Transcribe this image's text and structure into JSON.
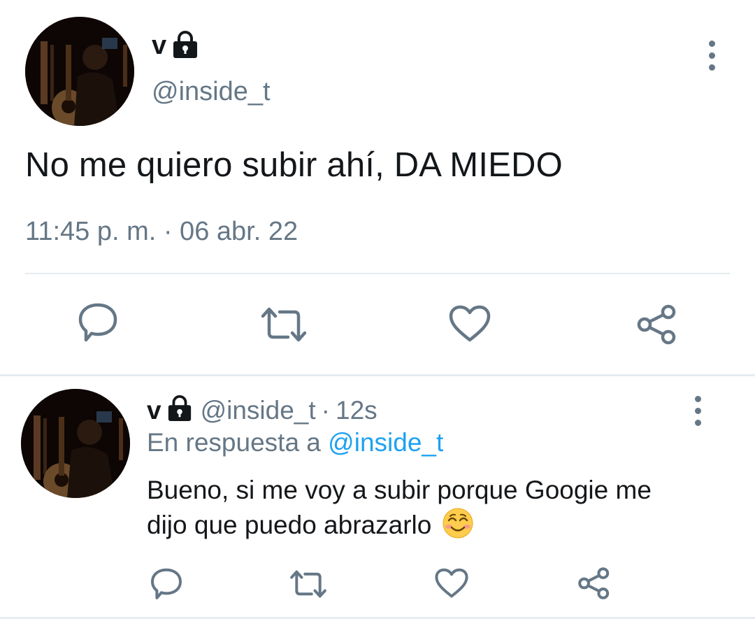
{
  "main_tweet": {
    "display_name": "v",
    "handle": "@inside_t",
    "text": "No me quiero subir ahí, DA MIEDO",
    "timestamp": "11:45 p. m. · 06 abr. 22"
  },
  "reply_tweet": {
    "display_name": "v",
    "handle": "@inside_t",
    "separator": "·",
    "time": "12s",
    "reply_prefix": "En respuesta a",
    "reply_mention": "@inside_t",
    "text": "Bueno, si me voy a subir porque Googie me dijo que puedo abrazarlo",
    "emoji": "smiling-face-with-smiling-eyes-emoji"
  },
  "icons": [
    "lock-icon",
    "more-options-icon",
    "reply-icon",
    "retweet-icon",
    "like-icon",
    "share-icon"
  ],
  "colors": {
    "text": "#14171a",
    "secondary": "#657786",
    "link": "#1da1f2",
    "divider": "#e6ecf0",
    "icon": "#657786"
  }
}
